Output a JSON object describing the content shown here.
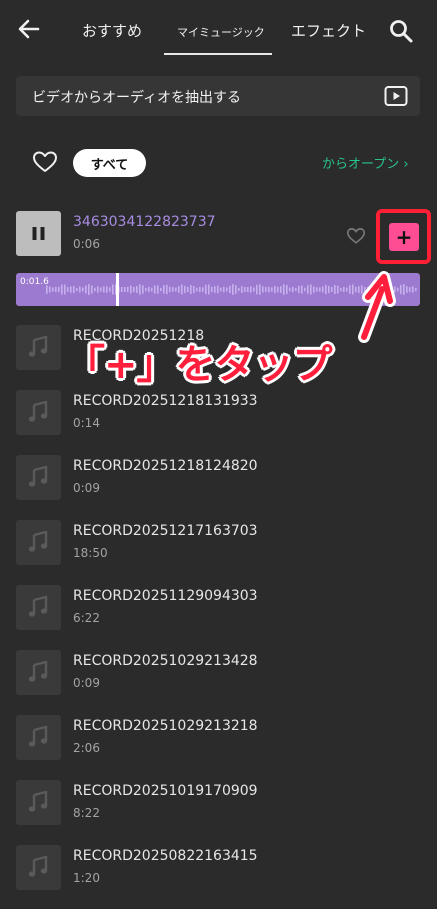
{
  "header": {
    "tabs": [
      {
        "label": "おすすめ"
      },
      {
        "label": "マイミュージック",
        "active": true
      },
      {
        "label": "エフェクト"
      }
    ]
  },
  "extract": {
    "label": "ビデオからオーディオを抽出する"
  },
  "filter": {
    "chip_label": "すべて",
    "open_link": "からオープン ›"
  },
  "active_track": {
    "title": "3463034122823737",
    "duration": "0:06",
    "current_time": "0:01.6",
    "add_label": "+"
  },
  "tracks": [
    {
      "title": "RECORD20251218",
      "duration": ""
    },
    {
      "title": "RECORD20251218131933",
      "duration": "0:14"
    },
    {
      "title": "RECORD20251218124820",
      "duration": "0:09"
    },
    {
      "title": "RECORD20251217163703",
      "duration": "18:50"
    },
    {
      "title": "RECORD20251129094303",
      "duration": "6:22"
    },
    {
      "title": "RECORD20251029213428",
      "duration": "0:09"
    },
    {
      "title": "RECORD20251029213218",
      "duration": "2:06"
    },
    {
      "title": "RECORD20251019170909",
      "duration": "8:22"
    },
    {
      "title": "RECORD20250822163415",
      "duration": "1:20"
    }
  ],
  "annotation": {
    "text": "「+」をタップ"
  },
  "colors": {
    "background": "#2b2b2b",
    "accent_green": "#28c48a",
    "active_purple": "#a88ce2",
    "waveform": "#9c7ad0",
    "add_button": "#ff4d94",
    "annotation_red": "#ff1e3c"
  }
}
